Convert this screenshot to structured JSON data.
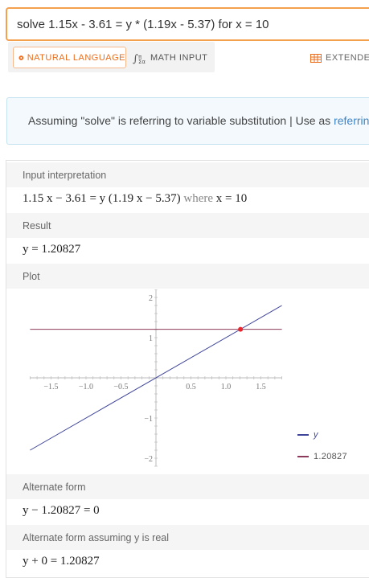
{
  "query": {
    "text": "solve 1.15x - 3.61 = y * (1.19x - 5.37) for x = 10"
  },
  "modes": {
    "natural_language": "NATURAL LANGUAGE",
    "math_input": "MATH INPUT",
    "extended": "EXTENDED"
  },
  "assumption": {
    "text": "Assuming \"solve\" is referring to variable substitution | Use as ",
    "link": "referring"
  },
  "pods": {
    "input_title": "Input interpretation",
    "input_lhs": "1.15 x − 3.61 = y (1.19 x − 5.37)",
    "input_where": "where",
    "input_cond": "x = 10",
    "result_title": "Result",
    "result": "y = 1.20827",
    "plot_title": "Plot",
    "alt_title": "Alternate form",
    "alt": "y − 1.20827 = 0",
    "alt_real_title": "Alternate form assuming y is real",
    "alt_real": "y + 0 = 1.20827"
  },
  "chart_data": {
    "type": "line",
    "xlim": [
      -1.8,
      1.8
    ],
    "ylim": [
      -2.2,
      2.2
    ],
    "x_ticks": [
      "-1.5",
      "-1.0",
      "-0.5",
      "0.5",
      "1.0",
      "1.5"
    ],
    "y_ticks": [
      "-2",
      "-1",
      "1",
      "2"
    ],
    "series": [
      {
        "name": "y",
        "color": "#3f4599",
        "x": [
          -1.8,
          1.8
        ],
        "y": [
          -1.8,
          1.8
        ]
      },
      {
        "name": "1.20827",
        "color": "#8b3a5a",
        "x": [
          -1.8,
          1.8
        ],
        "y": [
          1.20827,
          1.20827
        ]
      }
    ],
    "intersection": {
      "x": 1.20827,
      "y": 1.20827,
      "color": "#e8262c"
    },
    "legend": [
      "y",
      "1.20827"
    ]
  }
}
